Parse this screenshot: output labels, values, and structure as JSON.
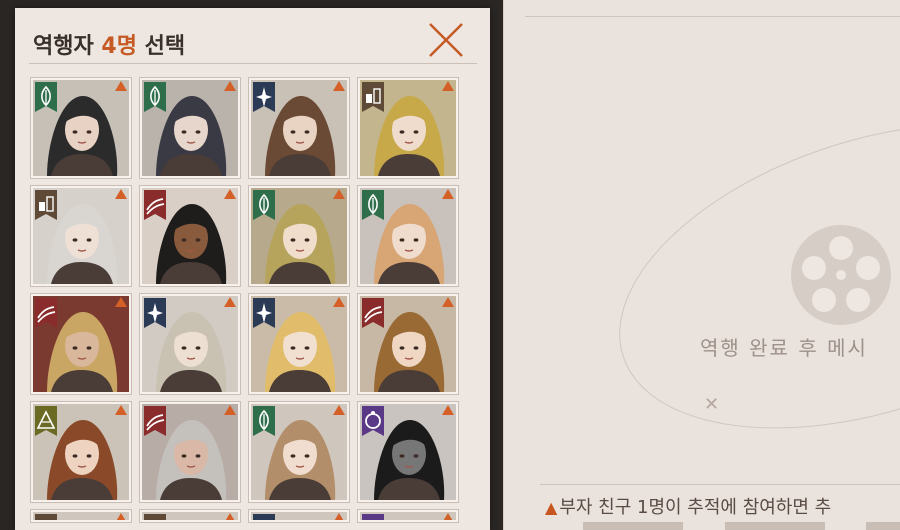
{
  "modal": {
    "title_prefix": "역행자 ",
    "title_count": "4명",
    "title_suffix": " 선택"
  },
  "background": {
    "message": "역행 완료 후 메시",
    "note": "부자 친구 1명이 추적에 참여하면 추"
  },
  "colors": {
    "accent": "#c65a24",
    "type_green": "#2f6e4a",
    "type_navy": "#2b3a55",
    "type_brown": "#5e4a36",
    "type_red": "#8a2c2c",
    "type_olive": "#6a6a24",
    "type_purple": "#5a3a86",
    "rarity": "#d45f27"
  },
  "characters": [
    {
      "type": "leaf-icon",
      "badge": "#2f6e4a",
      "hair": "#2b2b2b",
      "skin": "#e8d2c4",
      "bg": "#c7c0b6"
    },
    {
      "type": "leaf-icon",
      "badge": "#2f6e4a",
      "hair": "#3a3a44",
      "skin": "#e6d6cc",
      "bg": "#b9b3ab"
    },
    {
      "type": "star-icon",
      "badge": "#2b3a55",
      "hair": "#6a4a34",
      "skin": "#e9d3c2",
      "bg": "#c9c1b5"
    },
    {
      "type": "flag-icon",
      "badge": "#5e4a36",
      "hair": "#c7a94a",
      "skin": "#efdccd",
      "bg": "#c3b68f"
    },
    {
      "type": "flag-icon",
      "badge": "#5e4a36",
      "hair": "#d9d6d2",
      "skin": "#efe0d6",
      "bg": "#d6d1cb"
    },
    {
      "type": "claw-icon",
      "badge": "#8a2c2c",
      "hair": "#1f1c1c",
      "skin": "#8a5a3c",
      "bg": "#d9cfc6"
    },
    {
      "type": "leaf-icon",
      "badge": "#2f6e4a",
      "hair": "#b6a45c",
      "skin": "#f0ddcb",
      "bg": "#b7aa8c"
    },
    {
      "type": "leaf-icon",
      "badge": "#2f6e4a",
      "hair": "#d8a574",
      "skin": "#f0dccd",
      "bg": "#c9c2bc"
    },
    {
      "type": "claw-icon",
      "badge": "#8a2c2c",
      "hair": "#caa664",
      "skin": "#d9b79a",
      "bg": "#7b3a2f"
    },
    {
      "type": "star-icon",
      "badge": "#2b3a55",
      "hair": "#c9c1b2",
      "skin": "#eedfd3",
      "bg": "#d2cbc4"
    },
    {
      "type": "star-icon",
      "badge": "#2b3a55",
      "hair": "#e1bc6a",
      "skin": "#f1dfcf",
      "bg": "#c9bba8"
    },
    {
      "type": "claw-icon",
      "badge": "#8a2c2c",
      "hair": "#9a6a34",
      "skin": "#efd7c4",
      "bg": "#c7b8a6"
    },
    {
      "type": "pyramid-icon",
      "badge": "#6a6a24",
      "hair": "#8a4a2a",
      "skin": "#edd3c0",
      "bg": "#cbc3b8"
    },
    {
      "type": "claw-icon",
      "badge": "#8a2c2c",
      "hair": "#c4c0bc",
      "skin": "#d9b8a8",
      "bg": "#b8aca6"
    },
    {
      "type": "leaf-icon",
      "badge": "#2f6e4a",
      "hair": "#b38e6a",
      "skin": "#f0ddcf",
      "bg": "#cfc6bd"
    },
    {
      "type": "moon-icon",
      "badge": "#5a3a86",
      "hair": "#1b1b1b",
      "skin": "#777777",
      "bg": "#c9c4bf"
    }
  ],
  "partial_row": [
    {
      "type": "leaf-icon",
      "badge": "#5e4a36"
    },
    {
      "type": "claw-icon",
      "badge": "#5e4a36"
    },
    {
      "type": "star-icon",
      "badge": "#2b3a55"
    },
    {
      "type": "moon-icon",
      "badge": "#5a3a86"
    }
  ]
}
